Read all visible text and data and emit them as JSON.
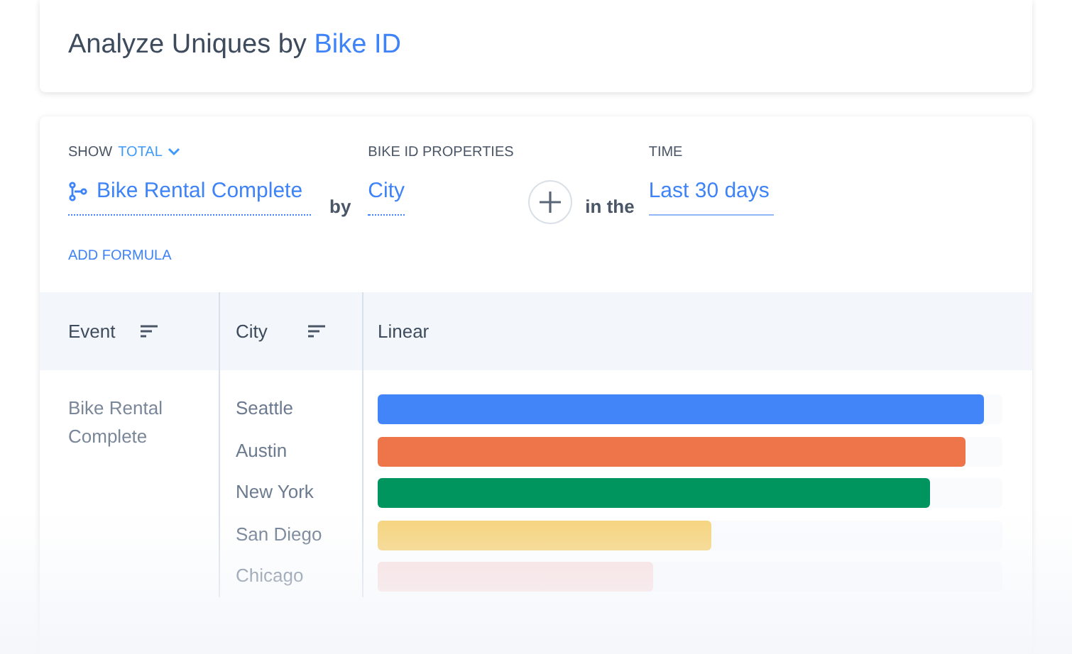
{
  "header": {
    "title": "Analyze Uniques by",
    "title_link": "Bike ID"
  },
  "query": {
    "show_label": "SHOW",
    "show_value": "TOTAL",
    "event": "Bike Rental Complete",
    "by": "by",
    "property_label": "BIKE ID PROPERTIES",
    "property": "City",
    "in_the": "in the",
    "time_label": "TIME",
    "time": "Last 30 days",
    "add_formula": "ADD FORMULA"
  },
  "table": {
    "columns": [
      "Event",
      "City",
      "Linear"
    ],
    "event": "Bike Rental Complete",
    "rows": [
      {
        "city": "Seattle",
        "level": 0.97,
        "color": "#4285f8"
      },
      {
        "city": "Austin",
        "level": 0.94,
        "color": "#ee744a"
      },
      {
        "city": "New York",
        "level": 0.885,
        "color": "#00945f"
      },
      {
        "city": "San Diego",
        "level": 0.535,
        "color": "#f6d37a"
      },
      {
        "city": "Chicago",
        "level": 0.44,
        "color": "#f9dede"
      }
    ]
  }
}
